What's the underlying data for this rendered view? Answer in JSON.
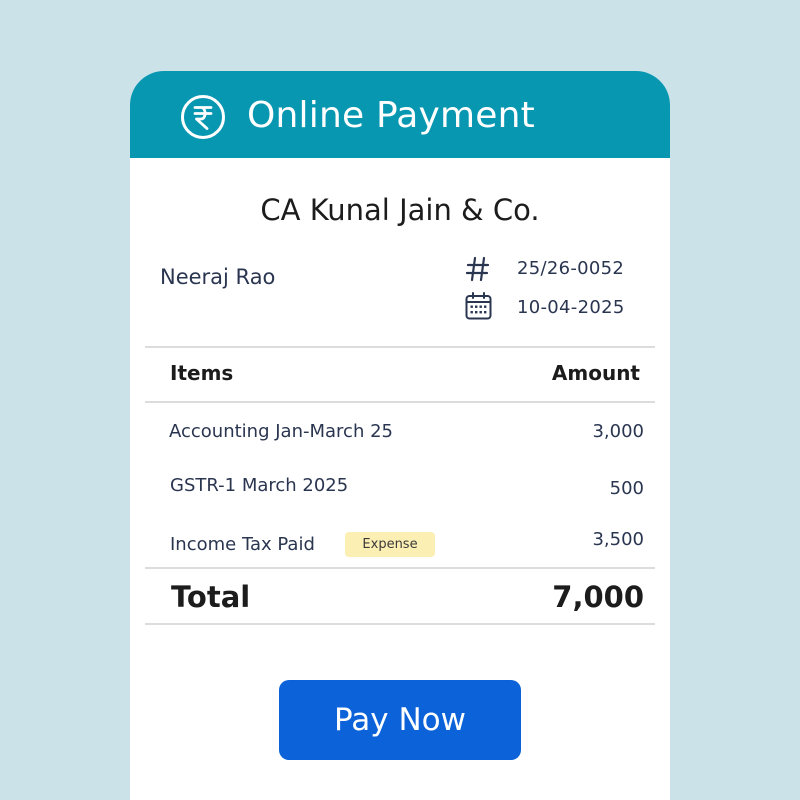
{
  "header": {
    "title": "Online Payment",
    "icon": "rupee-circle-icon",
    "color": "#0897b1"
  },
  "invoice": {
    "company": "CA Kunal Jain & Co.",
    "customer": "Neeraj Rao",
    "number": "25/26-0052",
    "number_icon": "hash-icon",
    "date": "10-04-2025",
    "date_icon": "calendar-icon"
  },
  "table": {
    "headers": {
      "items": "Items",
      "amount": "Amount"
    },
    "rows": [
      {
        "label": "Accounting Jan-March 25",
        "amount": "3,000"
      },
      {
        "label": "GSTR-1 March 2025",
        "amount": "500"
      },
      {
        "label": "Income Tax Paid",
        "badge": "Expense",
        "amount": "3,500"
      }
    ],
    "total_label": "Total",
    "total_value": "7,000"
  },
  "action": {
    "pay_label": "Pay Now",
    "color": "#0b62d9"
  }
}
